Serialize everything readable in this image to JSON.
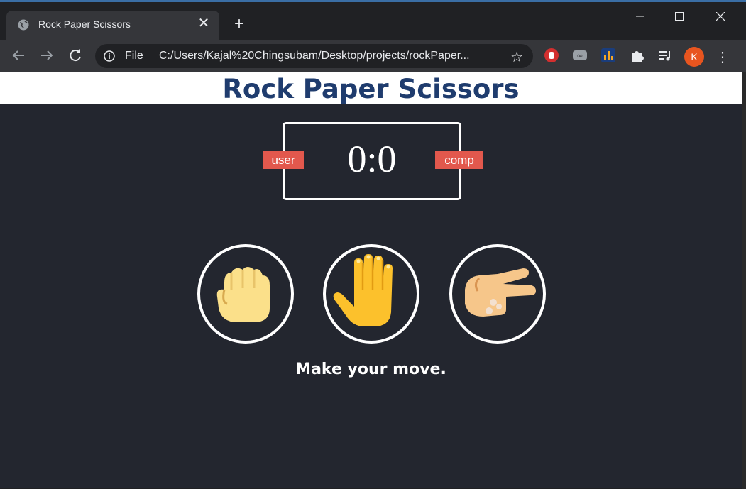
{
  "browser": {
    "tab_title": "Rock Paper Scissors",
    "tab_close": "✕",
    "new_tab": "+",
    "address": {
      "scheme_label": "File",
      "url": "C:/Users/Kajal%20Chingsubam/Desktop/projects/rockPaper..."
    },
    "profile_initial": "K",
    "menu_icon": "⋮",
    "star_icon": "☆"
  },
  "page": {
    "title": "Rock Paper Scissors",
    "score_text": "0:0",
    "user_label": "user",
    "comp_label": "comp",
    "choices": [
      {
        "name": "rock",
        "icon": "fist-icon"
      },
      {
        "name": "paper",
        "icon": "hand-icon"
      },
      {
        "name": "scissors",
        "icon": "victory-hand-icon"
      }
    ],
    "message": "Make your move."
  },
  "colors": {
    "page_bg": "#23262f",
    "title_color": "#1f3c6e",
    "badge_bg": "#e2584d",
    "accent_white": "#ffffff"
  }
}
